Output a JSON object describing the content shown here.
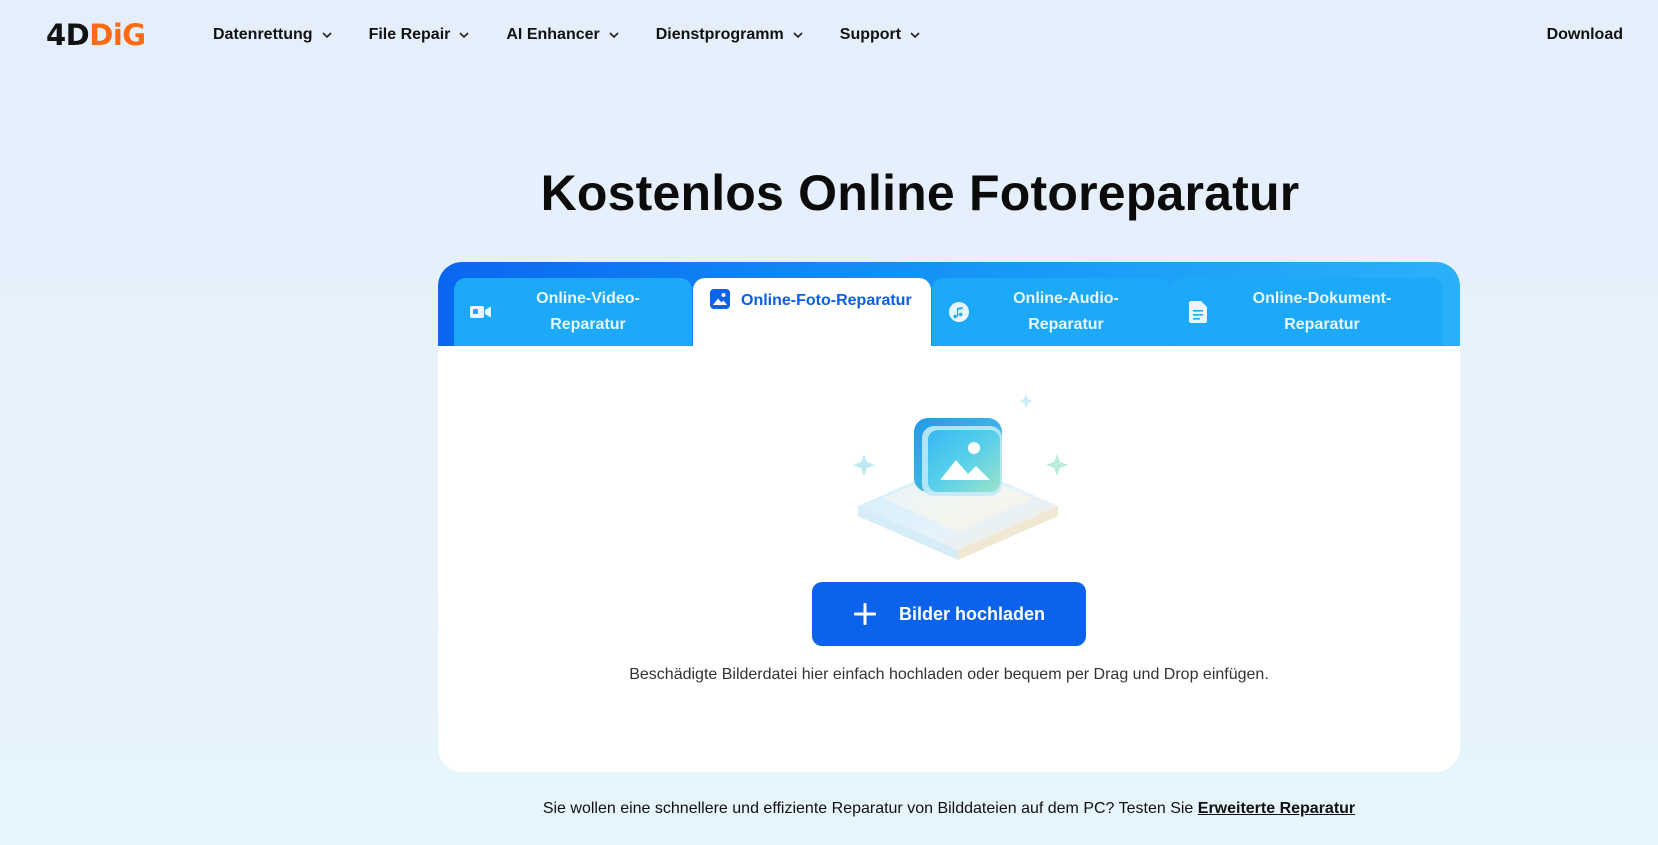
{
  "header": {
    "logo": {
      "part1": "4D",
      "part2": "DiG"
    },
    "nav": [
      {
        "label": "Datenrettung"
      },
      {
        "label": "File Repair"
      },
      {
        "label": "AI Enhancer"
      },
      {
        "label": "Dienstprogramm"
      },
      {
        "label": "Support"
      }
    ],
    "download_label": "Download"
  },
  "main": {
    "title": "Kostenlos Online Fotoreparatur",
    "tabs": [
      {
        "label_line1": "Online-Video-",
        "label_line2": "Reparatur",
        "icon": "video-camera-icon",
        "active": false
      },
      {
        "label_line1": "Online-Foto-Reparatur",
        "label_line2": "",
        "icon": "image-icon",
        "active": true
      },
      {
        "label_line1": "Online-Audio-",
        "label_line2": "Reparatur",
        "icon": "music-note-icon",
        "active": false
      },
      {
        "label_line1": "Online-Dokument-",
        "label_line2": "Reparatur",
        "icon": "document-icon",
        "active": false
      }
    ],
    "upload_button_label": "Bilder hochladen",
    "hint": "Beschädigte Bilderdatei hier einfach hochladen oder bequem per Drag und Drop einfügen."
  },
  "footer": {
    "note_text": "Sie wollen eine schnellere und effiziente Reparatur von Bilddateien auf dem PC? Testen Sie ",
    "note_link": "Erweiterte Reparatur"
  },
  "colors": {
    "brand_orange": "#ff6a13",
    "accent_blue": "#0b63ec",
    "tab_blue": "#1ba9f8"
  }
}
